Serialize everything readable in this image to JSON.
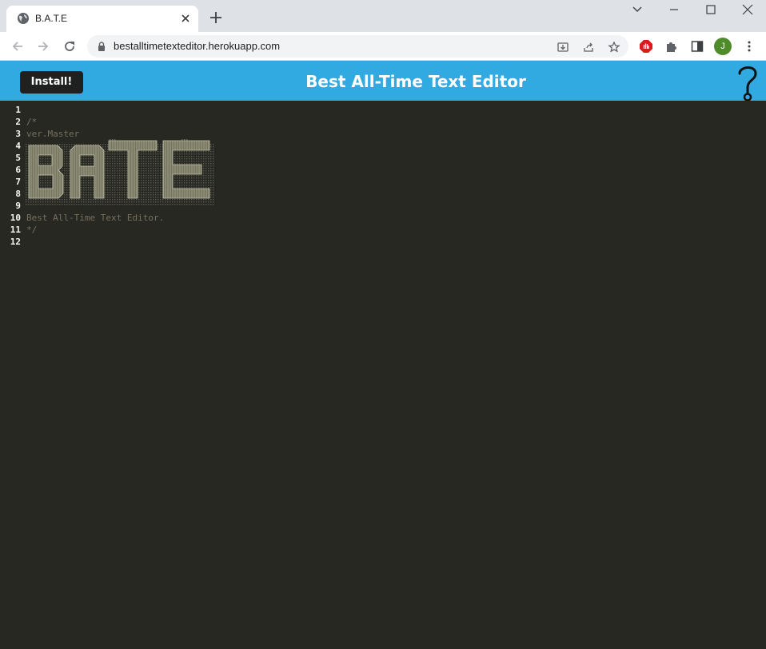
{
  "browser": {
    "tab_title": "B.A.T.E",
    "url": "bestalltimetexteditor.herokuapp.com",
    "avatar_initial": "J"
  },
  "app": {
    "install_label": "Install!",
    "title": "Best All-Time Text Editor"
  },
  "editor": {
    "line_numbers": [
      "1",
      "2",
      "3",
      "4",
      "5",
      "6",
      "7",
      "8",
      "9",
      "10",
      "11",
      "12"
    ],
    "lines": [
      "",
      "/*",
      "ver.Master",
      "",
      "",
      "",
      "",
      "",
      "",
      "Best All-Time Text Editor.",
      "*/",
      ""
    ],
    "ascii_art_text": "BATE"
  },
  "colors": {
    "header": "#31a9e1",
    "editor_bg": "#272822",
    "comment": "#75715e",
    "line_number": "#f8f8f2",
    "install_bg": "#1f2020"
  },
  "icons": [
    "globe-icon",
    "close-icon",
    "plus-icon",
    "chevron-down-icon",
    "minimize-icon",
    "maximize-icon",
    "window-close-icon",
    "back-icon",
    "forward-icon",
    "reload-icon",
    "lock-icon",
    "install-app-icon",
    "share-icon",
    "star-icon",
    "extension-red-icon",
    "puzzle-icon",
    "sidepanel-icon",
    "menu-dots-icon",
    "question-icon"
  ]
}
